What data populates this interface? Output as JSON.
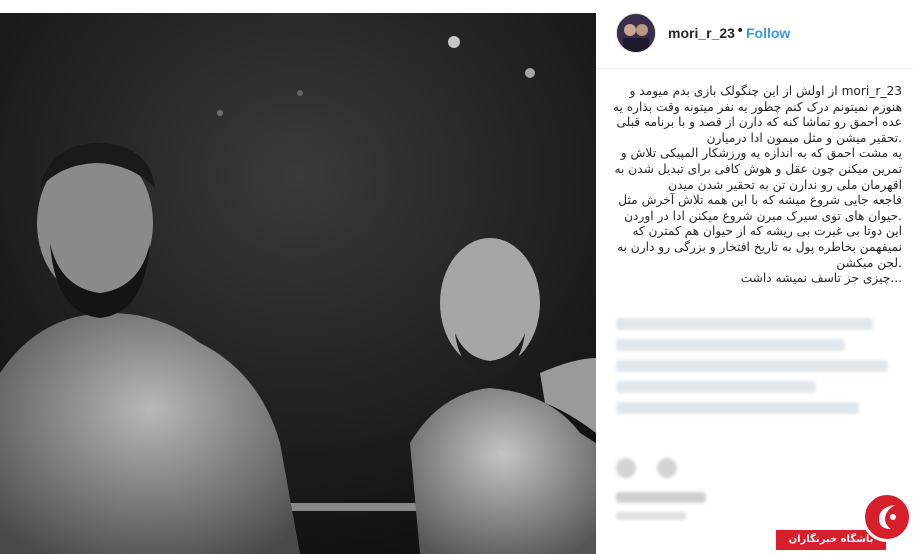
{
  "post": {
    "username": "mori_r_23",
    "separator": "•",
    "follow_label": "Follow",
    "caption_lines": [
      "mori_r_23 از اولش از این چنگولک بازی بدم میومد و",
      "هنوزم نمیتونم درک کنم چطور یه نفر میتونه وقت بذاره یه",
      "عده احمق رو تماشا کنه که دارن از قصد و با برنامه قبلی",
      ".تحقیر میشن و مثل میمون ادا درمیارن",
      "یه مشت احمق که به اندازه یه ورزشکار المپیکی تلاش و",
      "تمرین میکنن چون عقل و هوش کافی برای تبدیل شدن به",
      "اقهرمان ملی رو ندارن تن به تحقیر شدن میدن",
      "فاجعه جایی شروع میشه که با این همه تلاش آخرش مثل",
      ".حیوان های توی سیرک میرن شروع میکنن ادا در اوردن",
      "این دوتا بی غیرت بی ریشه که از حیوان هم کمترن که",
      "نمیفهمن بخاطره پول به تاریخ افتخار و بزرگی رو دارن به",
      ".لجن میکشن",
      "...چیزی جز تاسف نمیشه داشت"
    ]
  },
  "watermark": {
    "text": "باشگاه خبرنگاران"
  },
  "icons": {
    "avatar": "profile-avatar",
    "heart": "heart-icon",
    "comment": "comment-icon",
    "logo": "yjc-logo-icon"
  },
  "colors": {
    "follow": "#3897f0",
    "watermark": "#d71e2b"
  }
}
